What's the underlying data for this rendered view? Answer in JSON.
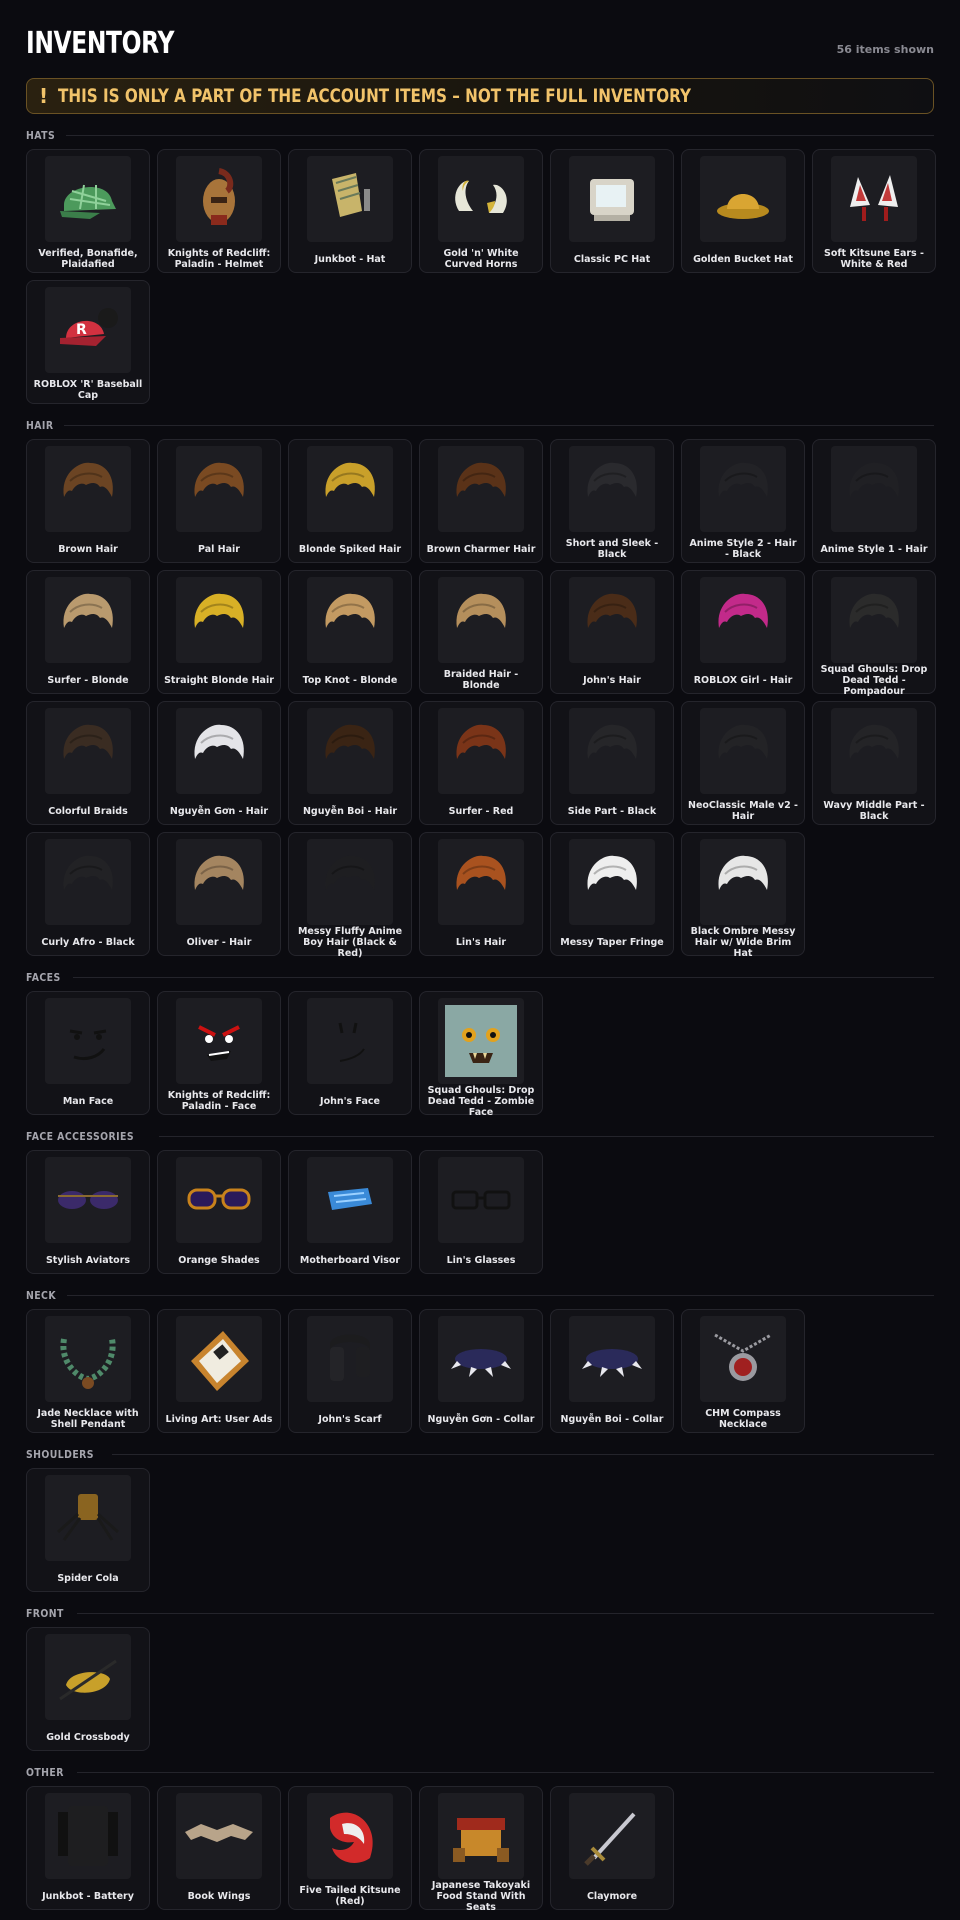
{
  "header": {
    "title": "INVENTORY",
    "count": "56 items shown"
  },
  "banner": {
    "icon": "exclamation-icon",
    "text": "THIS IS ONLY A PART OF THE ACCOUNT ITEMS – NOT THE FULL INVENTORY",
    "mark": "!"
  },
  "colors": {
    "background": "#0b0b10",
    "accent": "#f1c36a",
    "card": "#121217"
  },
  "sections": [
    {
      "title": "HATS",
      "items": [
        {
          "name": "Verified, Bonafide, Plaidafied",
          "icon": "plaid-cap-icon"
        },
        {
          "name": "Knights of Redcliff: Paladin - Helmet",
          "icon": "helmet-icon"
        },
        {
          "name": "Junkbot - Hat",
          "icon": "junkbot-hat-icon"
        },
        {
          "name": "Gold 'n' White Curved Horns",
          "icon": "horns-icon"
        },
        {
          "name": "Classic PC Hat",
          "icon": "pc-hat-icon"
        },
        {
          "name": "Golden Bucket Hat",
          "icon": "bucket-hat-icon"
        },
        {
          "name": "Soft Kitsune Ears - White & Red",
          "icon": "kitsune-ears-icon"
        },
        {
          "name": "ROBLOX 'R' Baseball Cap",
          "icon": "baseball-cap-icon"
        }
      ]
    },
    {
      "title": "HAIR",
      "items": [
        {
          "name": "Brown Hair",
          "icon": "hair-icon",
          "color": "#6b4423"
        },
        {
          "name": "Pal Hair",
          "icon": "hair-icon",
          "color": "#7a4a22"
        },
        {
          "name": "Blonde Spiked Hair",
          "icon": "hair-icon",
          "color": "#c9a02a"
        },
        {
          "name": "Brown Charmer Hair",
          "icon": "hair-icon",
          "color": "#5a3218"
        },
        {
          "name": "Short and Sleek - Black",
          "icon": "hair-icon",
          "color": "#2a2a2e"
        },
        {
          "name": "Anime Style 2 - Hair - Black",
          "icon": "hair-icon",
          "color": "#222226"
        },
        {
          "name": "Anime Style 1 - Hair",
          "icon": "hair-icon",
          "color": "#202024"
        },
        {
          "name": "Surfer - Blonde",
          "icon": "hair-icon",
          "color": "#b99a6e"
        },
        {
          "name": "Straight Blonde Hair",
          "icon": "hair-icon",
          "color": "#d8b026"
        },
        {
          "name": "Top Knot - Blonde",
          "icon": "hair-icon",
          "color": "#c39a62"
        },
        {
          "name": "Braided Hair - Blonde",
          "icon": "hair-icon",
          "color": "#b58f5c"
        },
        {
          "name": "John's Hair",
          "icon": "hair-icon",
          "color": "#4a2c18"
        },
        {
          "name": "ROBLOX Girl - Hair",
          "icon": "hair-icon",
          "color": "#c22a8a"
        },
        {
          "name": "Squad Ghouls: Drop Dead Tedd - Pompadour",
          "icon": "hair-icon",
          "color": "#2b2b2b"
        },
        {
          "name": "Colorful Braids",
          "icon": "hair-icon",
          "color": "#3a2c22"
        },
        {
          "name": "Nguyễn Gơn - Hair",
          "icon": "hair-icon",
          "color": "#e4e4e8"
        },
        {
          "name": "Nguyễn Boi - Hair",
          "icon": "hair-icon",
          "color": "#3a2414"
        },
        {
          "name": "Surfer - Red",
          "icon": "hair-icon",
          "color": "#7a3418"
        },
        {
          "name": "Side Part - Black",
          "icon": "hair-icon",
          "color": "#262629"
        },
        {
          "name": "NeoClassic Male v2 - Hair",
          "icon": "hair-icon",
          "color": "#232326"
        },
        {
          "name": "Wavy Middle Part - Black",
          "icon": "hair-icon",
          "color": "#242427"
        },
        {
          "name": "Curly Afro - Black",
          "icon": "hair-icon",
          "color": "#222225"
        },
        {
          "name": "Oliver - Hair",
          "icon": "hair-icon",
          "color": "#a48560"
        },
        {
          "name": "Messy Fluffy Anime Boy Hair (Black & Red)",
          "icon": "hair-icon",
          "color": "#1e1e21"
        },
        {
          "name": "Lin's Hair",
          "icon": "hair-icon",
          "color": "#a9521f"
        },
        {
          "name": "Messy Taper Fringe",
          "icon": "hair-icon",
          "color": "#eeeeee"
        },
        {
          "name": "Black Ombre Messy Hair w/ Wide Brim Hat",
          "icon": "hair-icon",
          "color": "#e6e6e6"
        }
      ]
    },
    {
      "title": "FACES",
      "items": [
        {
          "name": "Man Face",
          "icon": "face-icon"
        },
        {
          "name": "Knights of Redcliff: Paladin - Face",
          "icon": "angry-face-icon"
        },
        {
          "name": "John's Face",
          "icon": "smirk-face-icon"
        },
        {
          "name": "Squad Ghouls: Drop Dead Tedd - Zombie Face",
          "icon": "zombie-face-icon"
        }
      ]
    },
    {
      "title": "FACE ACCESSORIES",
      "items": [
        {
          "name": "Stylish Aviators",
          "icon": "aviators-icon"
        },
        {
          "name": "Orange Shades",
          "icon": "shades-icon"
        },
        {
          "name": "Motherboard Visor",
          "icon": "visor-icon"
        },
        {
          "name": "Lin's Glasses",
          "icon": "glasses-icon"
        }
      ]
    },
    {
      "title": "NECK",
      "items": [
        {
          "name": "Jade Necklace with Shell Pendant",
          "icon": "necklace-icon"
        },
        {
          "name": "Living Art: User Ads",
          "icon": "picture-frame-icon"
        },
        {
          "name": "John's Scarf",
          "icon": "scarf-icon"
        },
        {
          "name": "Nguyễn Gơn - Collar",
          "icon": "spiked-collar-icon"
        },
        {
          "name": "Nguyễn Boi - Collar",
          "icon": "spiked-collar-icon"
        },
        {
          "name": "CHM Compass Necklace",
          "icon": "compass-necklace-icon"
        }
      ]
    },
    {
      "title": "SHOULDERS",
      "items": [
        {
          "name": "Spider Cola",
          "icon": "spider-icon"
        }
      ]
    },
    {
      "title": "FRONT",
      "items": [
        {
          "name": "Gold Crossbody",
          "icon": "crossbody-bag-icon"
        }
      ]
    },
    {
      "title": "OTHER",
      "items": [
        {
          "name": "Junkbot - Battery",
          "icon": "battery-icon"
        },
        {
          "name": "Book Wings",
          "icon": "wings-icon"
        },
        {
          "name": "Five Tailed Kitsune (Red)",
          "icon": "kitsune-tails-icon"
        },
        {
          "name": "Japanese Takoyaki Food Stand With Seats",
          "icon": "food-stand-icon"
        },
        {
          "name": "Claymore",
          "icon": "sword-icon"
        }
      ]
    }
  ]
}
